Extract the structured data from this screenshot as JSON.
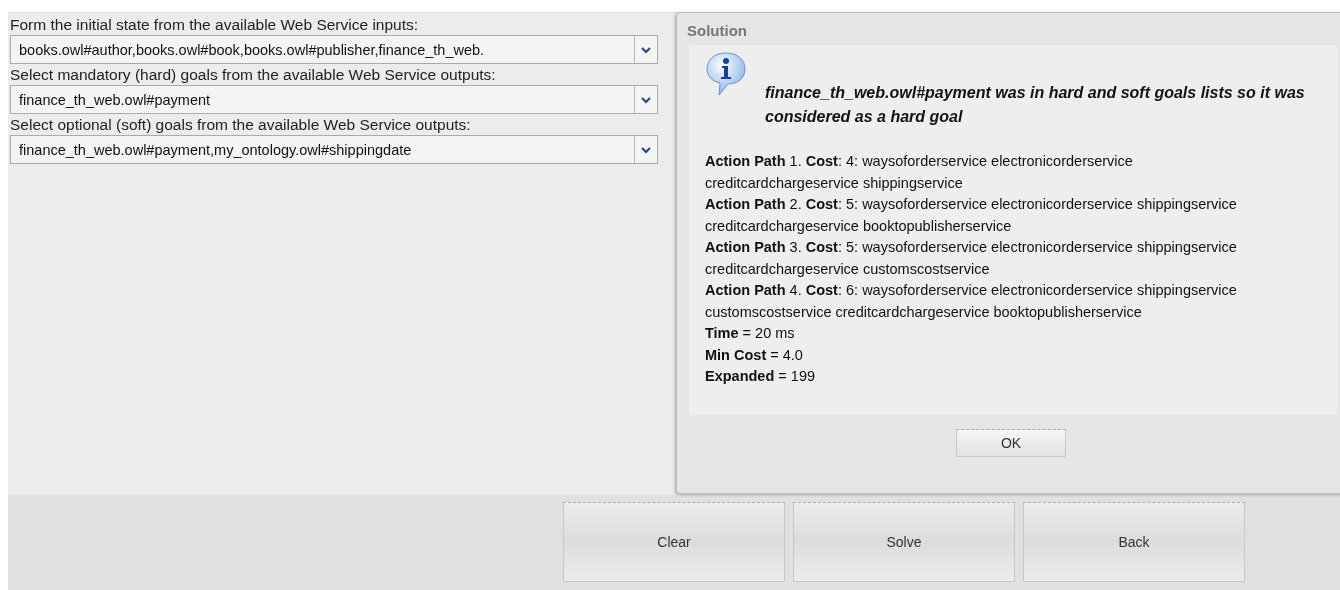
{
  "form": {
    "fields": [
      {
        "label": "Form the initial state from the available Web Service inputs:",
        "value": "books.owl#author,books.owl#book,books.owl#publisher,finance_th_web."
      },
      {
        "label": "Select mandatory (hard) goals from the available Web Service outputs:",
        "value": "finance_th_web.owl#payment"
      },
      {
        "label": "Select optional (soft) goals from the available Web Service outputs:",
        "value": "finance_th_web.owl#payment,my_ontology.owl#shippingdate"
      }
    ]
  },
  "dialog": {
    "title": "Solution",
    "message": "finance_th_web.owl#payment was in hard and soft goals lists so it was considered as a hard goal",
    "lines": [
      "**Action Path** 1. **Cost**: 4: waysoforderservice electronicorderservice creditcardchargeservice shippingservice",
      "**Action Path** 2. **Cost**: 5: waysoforderservice electronicorderservice shippingservice creditcardchargeservice booktopublisherservice",
      "**Action Path** 3. **Cost**: 5: waysoforderservice electronicorderservice shippingservice creditcardchargeservice customscostservice",
      "**Action Path** 4. **Cost**: 6: waysoforderservice electronicorderservice shippingservice customscostservice creditcardchargeservice booktopublisherservice",
      "**Time** = 20 ms",
      "**Min Cost** = 4.0",
      "**Expanded** = 199"
    ],
    "button": "OK"
  },
  "buttons": [
    "Clear",
    "Solve",
    "Back"
  ]
}
